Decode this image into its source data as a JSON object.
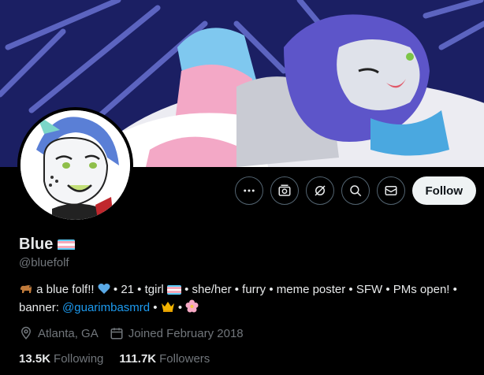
{
  "profile": {
    "display_name": "Blue",
    "handle": "@bluefolf",
    "follow_label": "Follow",
    "bio": {
      "part1": "a blue folf!!",
      "part2": " • 21 • tgirl ",
      "part3": "• she/her • furry • meme poster • SFW • PMs open! •",
      "banner_label": "banner: ",
      "banner_link": "@guarimbasmrd",
      "sep": " • "
    },
    "location": "Atlanta, GA",
    "joined": "Joined February 2018",
    "following_count": "13.5K",
    "following_label": "Following",
    "followers_count": "111.7K",
    "followers_label": "Followers"
  },
  "actions": {
    "icons": [
      "more-icon",
      "subscribe-icon",
      "grok-icon",
      "search-icon",
      "message-icon"
    ]
  },
  "colors": {
    "background": "#000000",
    "text_primary": "#e7e9ea",
    "text_secondary": "#71767b",
    "link": "#1d9bf0",
    "follow_bg": "#eff3f4",
    "trans_blue": "#5BCEFA",
    "trans_pink": "#F5A9B8",
    "trans_white": "#FFFFFF"
  }
}
